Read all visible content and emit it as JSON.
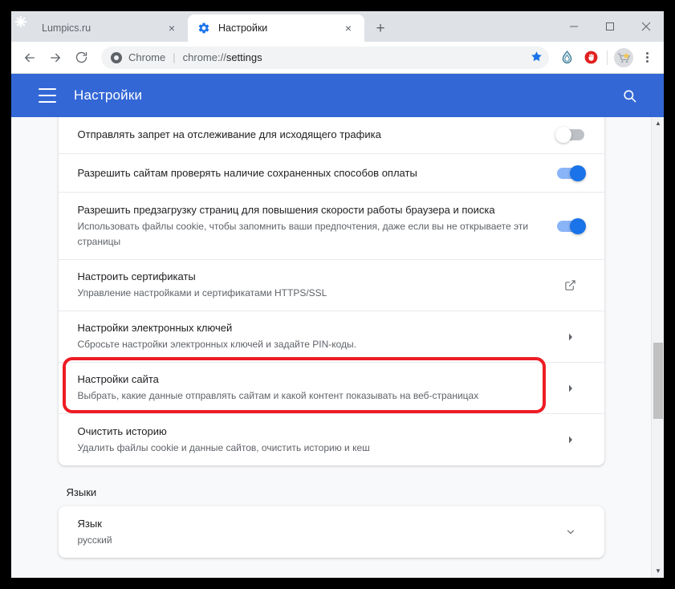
{
  "browser": {
    "tabs": [
      {
        "title": "Lumpics.ru",
        "favicon": "lumpics-icon",
        "active": false,
        "close_label": "×"
      },
      {
        "title": "Настройки",
        "favicon": "gear-icon",
        "active": true,
        "close_label": "×"
      }
    ],
    "new_tab_label": "+",
    "window_controls": {
      "minimize": "minimize-icon",
      "maximize": "maximize-icon",
      "close": "close-icon"
    },
    "nav": {
      "back": "back-arrow-icon",
      "forward": "forward-arrow-icon",
      "reload": "reload-icon"
    },
    "omnibox": {
      "site_icon": "chrome-icon",
      "site_label": "Chrome",
      "separator": "|",
      "url_scheme": "chrome://",
      "url_path": "settings",
      "bookmark_icon": "star-icon"
    },
    "extensions": [
      {
        "name": "water-drop-extension-icon"
      },
      {
        "name": "adblock-stop-hand-icon"
      }
    ],
    "profile_avatar": "avatar",
    "menu": "three-dot-menu-icon"
  },
  "settings_header": {
    "menu_icon": "hamburger-menu-icon",
    "title": "Настройки",
    "search_icon": "search-icon",
    "background_color": "#3367d6"
  },
  "main": {
    "rows": [
      {
        "title": "Отправлять запрет на отслеживание для исходящего трафика",
        "sub": "",
        "control": "toggle",
        "toggle_state": "off"
      },
      {
        "title": "Разрешить сайтам проверять наличие сохраненных способов оплаты",
        "sub": "",
        "control": "toggle",
        "toggle_state": "on"
      },
      {
        "title": "Разрешить предзагрузку страниц для повышения скорости работы браузера и поиска",
        "sub": "Использовать файлы cookie, чтобы запомнить ваши предпочтения, даже если вы не открываете эти страницы",
        "control": "toggle",
        "toggle_state": "on"
      },
      {
        "title": "Настроить сертификаты",
        "sub": "Управление настройками и сертификатами HTTPS/SSL",
        "control": "external-link"
      },
      {
        "title": "Настройки электронных ключей",
        "sub": "Сбросьте настройки электронных ключей и задайте PIN-коды.",
        "control": "chevron-right"
      },
      {
        "title": "Настройки сайта",
        "sub": "Выбрать, какие данные отправлять сайтам и какой контент показывать на веб-страницах",
        "control": "chevron-right",
        "highlighted": true
      },
      {
        "title": "Очистить историю",
        "sub": "Удалить файлы cookie и данные сайтов, очистить историю и кеш",
        "control": "chevron-right"
      }
    ],
    "languages_section": {
      "heading": "Языки",
      "row": {
        "title": "Язык",
        "sub": "русский",
        "control": "chevron-down"
      }
    },
    "highlight_color": "#ee1c25"
  },
  "scrollbar": {
    "up_arrow": "▲",
    "down_arrow": "▼"
  }
}
